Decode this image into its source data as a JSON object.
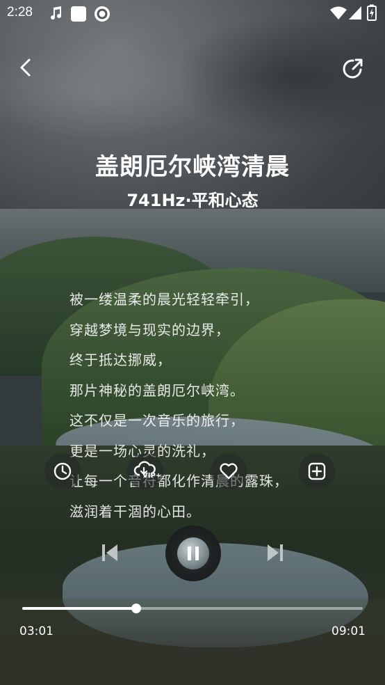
{
  "status_bar": {
    "time": "2:28"
  },
  "header": {
    "title": "盖朗厄尔峡湾清晨",
    "subtitle": "741Hz·平和心态"
  },
  "lyrics": [
    "被一缕温柔的晨光轻轻牵引，",
    "穿越梦境与现实的边界，",
    "终于抵达挪威，",
    "那片神秘的盖朗厄尔峡湾。",
    "这不仅是一次音乐的旅行，",
    "更是一场心灵的洗礼，",
    "让每一个音符都化作清晨的露珠，",
    "滋润着干涸的心田。"
  ],
  "actions": {
    "vip_badge": "VIP+"
  },
  "player": {
    "current_time": "03:01",
    "total_time": "09:01",
    "progress": 0.334
  }
}
